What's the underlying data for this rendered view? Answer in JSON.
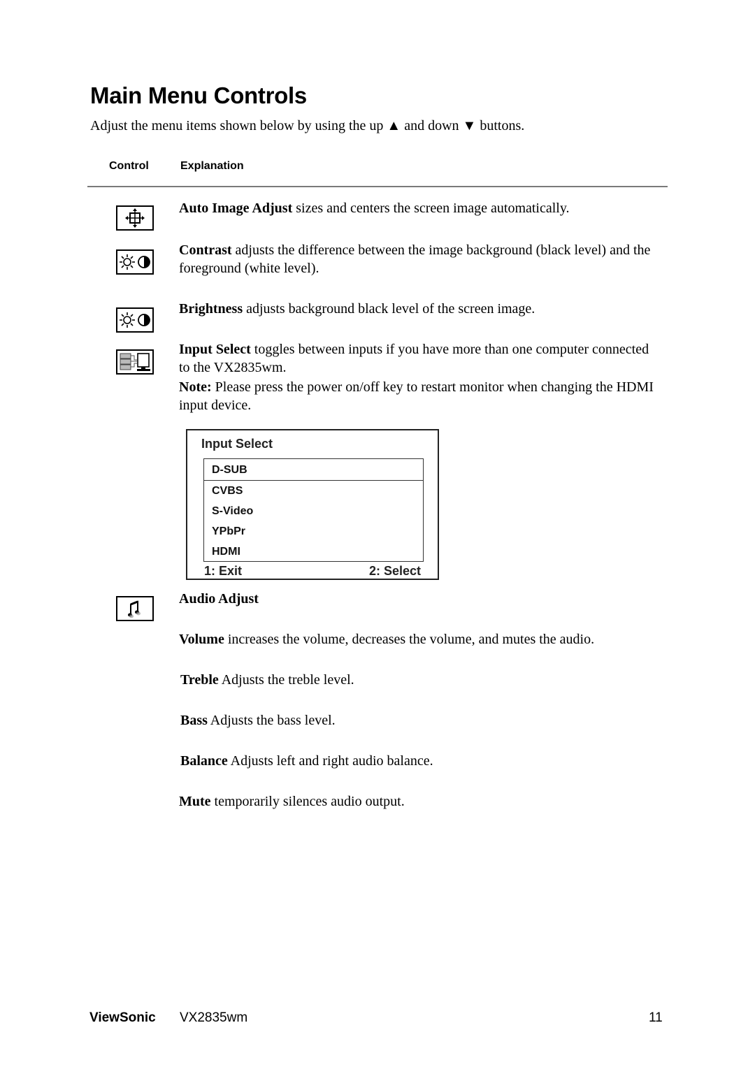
{
  "page": {
    "title": "Main Menu Controls",
    "intro": {
      "before_up": "Adjust the menu items shown below by using the up ",
      "up_glyph": "▲",
      "between": " and down ",
      "down_glyph": "▼",
      "after_down": " buttons."
    },
    "table_headers": {
      "control": "Control",
      "explanation": "Explanation"
    }
  },
  "controls": [
    {
      "icon": "auto-image-adjust-icon",
      "name": "Auto Image Adjust",
      "text": " sizes and centers the screen image automatically."
    },
    {
      "icon": "contrast-icon",
      "name": "Contrast",
      "text": " adjusts the difference between the image background  (black level) and the foreground (white level)."
    },
    {
      "icon": "brightness-icon",
      "name": "Brightness",
      "text": " adjusts background black level of the screen image."
    },
    {
      "icon": "input-select-icon",
      "name": "Input Select",
      "text": " toggles between inputs if you have more than one computer connected to the VX2835wm.",
      "note_label": "Note:",
      "note_text": " Please press the power on/off key to restart monitor when changing the HDMI input device."
    },
    {
      "icon": "audio-adjust-icon",
      "name": "Audio Adjust"
    }
  ],
  "input_select_osd": {
    "title": "Input Select",
    "options": [
      "D-SUB",
      "CVBS",
      "S-Video",
      "YPbPr",
      "HDMI"
    ],
    "selected": "D-SUB",
    "exit_label": "1: Exit",
    "select_label": "2: Select"
  },
  "audio_items": [
    {
      "name": "Volume",
      "text": " increases the volume, decreases the volume, and mutes the audio."
    },
    {
      "name": "Treble",
      "text": " Adjusts the treble level."
    },
    {
      "name": "Bass",
      "text": " Adjusts the bass level."
    },
    {
      "name": "Balance",
      "text": " Adjusts left and right audio balance."
    },
    {
      "name": "Mute",
      "text": " temporarily silences audio output."
    }
  ],
  "footer": {
    "brand": "ViewSonic",
    "model": "VX2835wm",
    "page_number": "11"
  }
}
